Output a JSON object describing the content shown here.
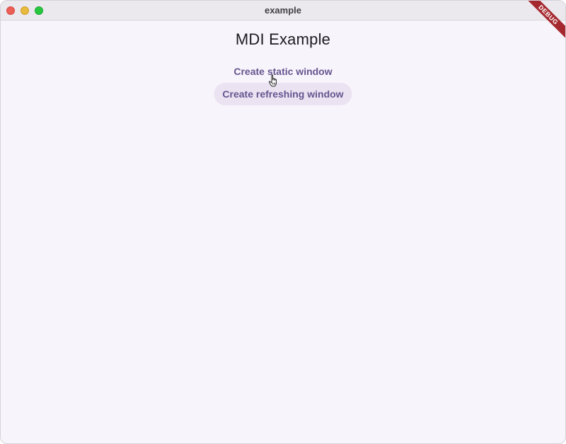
{
  "window": {
    "title": "example"
  },
  "main": {
    "title": "MDI Example",
    "buttons": {
      "static_label": "Create static window",
      "refreshing_label": "Create refreshing window"
    }
  },
  "debug_banner": {
    "label": "DEBUG"
  },
  "colors": {
    "background": "#f8f4fb",
    "button_text": "#65558f",
    "button_hover_bg": "#ebe3f2",
    "debug_ribbon": "#a5282f"
  },
  "icons": {
    "cursor": "pointer-hand-icon"
  }
}
